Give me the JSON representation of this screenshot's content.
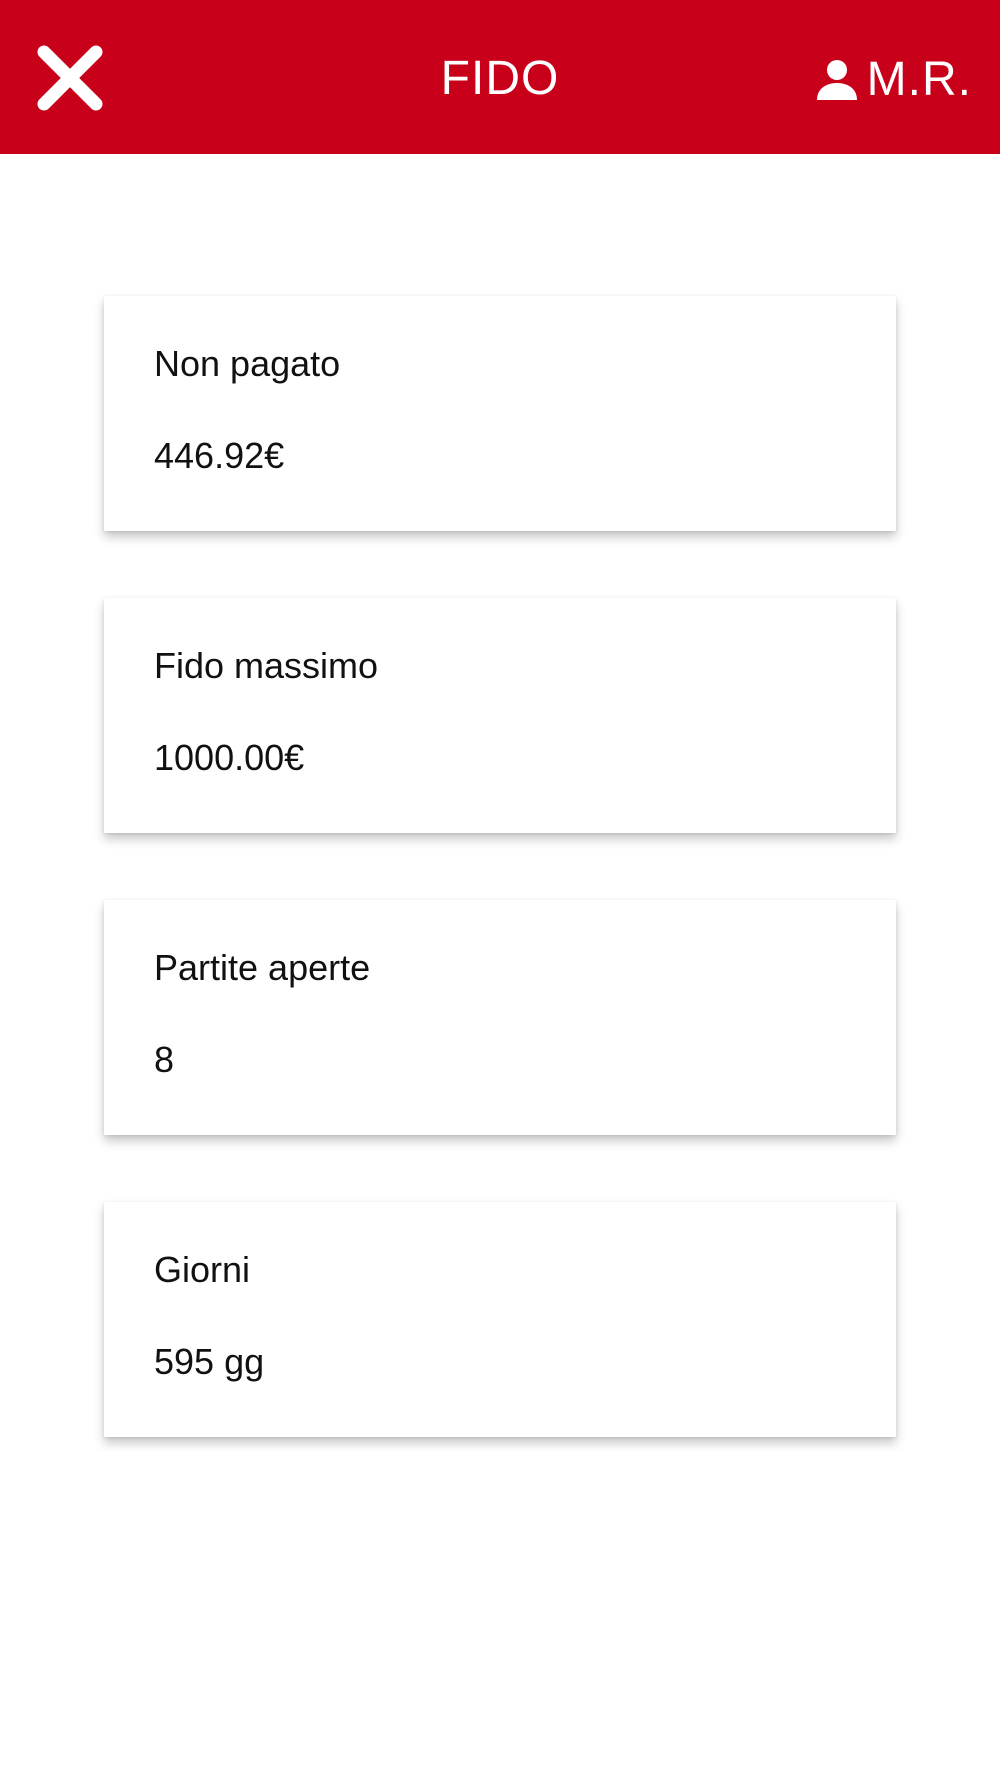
{
  "header": {
    "title": "FIDO",
    "user_initials": "M.R.",
    "background_color": "#c8001a",
    "close_icon": "close-icon",
    "user_icon": "user-icon"
  },
  "cards": [
    {
      "label": "Non pagato",
      "value": "446.92€"
    },
    {
      "label": "Fido massimo",
      "value": "1000.00€"
    },
    {
      "label": "Partite aperte",
      "value": "8"
    },
    {
      "label": "Giorni",
      "value": "595 gg"
    }
  ]
}
